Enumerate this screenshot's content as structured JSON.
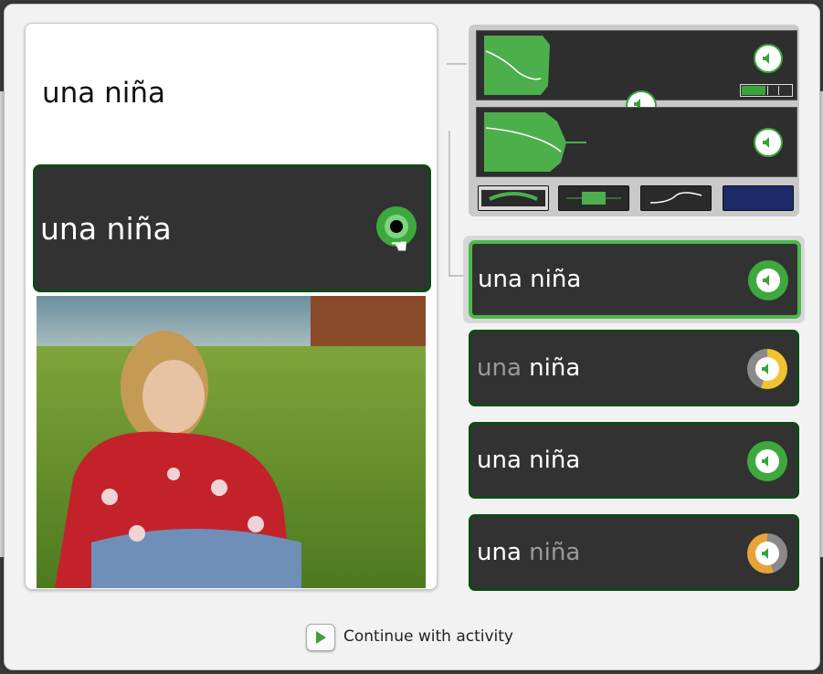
{
  "prompt_word": "una niña",
  "recording_row": {
    "label": "una niña"
  },
  "choices": [
    {
      "part1": "una",
      "part2": "niña",
      "dim1": false,
      "dim2": false,
      "score_color": "#3ea83e",
      "selected": true
    },
    {
      "part1": "una",
      "part2": "niña",
      "dim1": true,
      "dim2": false,
      "score_color": "#f2c230",
      "selected": false
    },
    {
      "part1": "una",
      "part2": "niña",
      "dim1": false,
      "dim2": false,
      "score_color": "#3ea83e",
      "selected": false
    },
    {
      "part1": "una",
      "part2": "niña",
      "dim1": false,
      "dim2": true,
      "score_color": "#e8a23a",
      "selected": false
    }
  ],
  "footer": {
    "continue_label": "Continue with activity"
  },
  "colors": {
    "accent": "#3ea83e",
    "dark_row": "#323232",
    "row_border": "#0d4a16"
  },
  "level_meter": {
    "fraction": 0.5
  },
  "icons": {
    "record": "record-icon",
    "speaker": "speaker-icon",
    "play": "play-icon",
    "cursor": "hand-cursor-icon"
  }
}
